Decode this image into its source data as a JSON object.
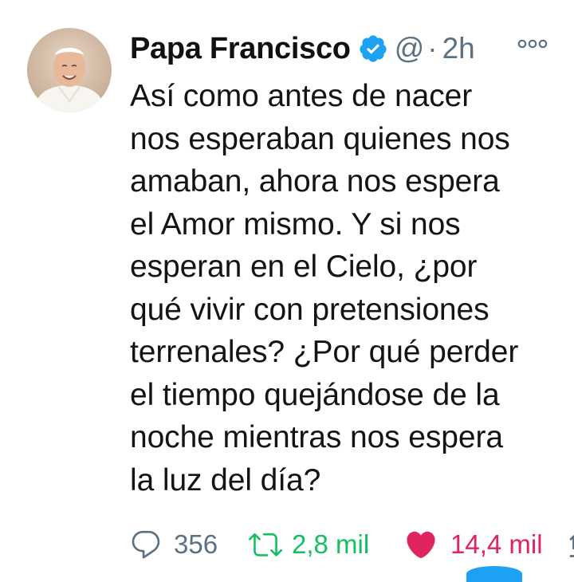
{
  "tweet": {
    "author": {
      "display_name": "Papa Francisco",
      "handle": "@",
      "verified_icon": "verified-badge-icon"
    },
    "separator": "·",
    "timestamp": "2h",
    "text": "Así como antes de nacer\nnos esperaban quienes nos\namaban, ahora nos espera\nel Amor mismo. Y si nos\nesperan en el Cielo, ¿por\nqué vivir con pretensiones\nterrenales? ¿Por qué perder\nel tiempo quejándose de la\nnoche mientras nos espera\nla luz del día?",
    "actions": {
      "reply_count": "356",
      "retweet_count": "2,8 mil",
      "like_count": "14,4 mil"
    }
  },
  "colors": {
    "verified": "#1da1f2",
    "muted": "#5b7083",
    "retweet": "#17bf63",
    "like": "#e0245e"
  }
}
